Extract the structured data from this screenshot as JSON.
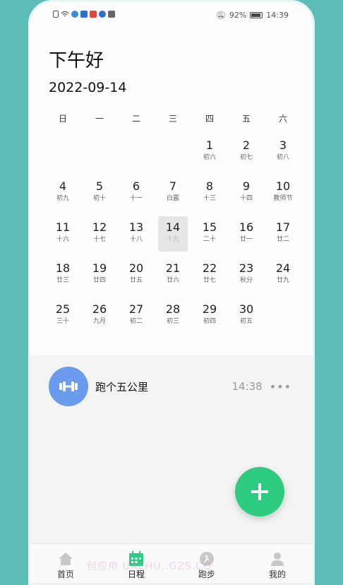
{
  "status_bar": {
    "battery": "92%",
    "time": "14:39"
  },
  "greeting": "下午好",
  "date": "2022-09-14",
  "weekdays": [
    "日",
    "一",
    "二",
    "三",
    "四",
    "五",
    "六"
  ],
  "calendar": {
    "selected_day": "14",
    "rows": [
      [
        {
          "day": "",
          "lunar": ""
        },
        {
          "day": "",
          "lunar": ""
        },
        {
          "day": "",
          "lunar": ""
        },
        {
          "day": "",
          "lunar": ""
        },
        {
          "day": "1",
          "lunar": "初六"
        },
        {
          "day": "2",
          "lunar": "初七"
        },
        {
          "day": "3",
          "lunar": "初八"
        }
      ],
      [
        {
          "day": "4",
          "lunar": "初九"
        },
        {
          "day": "5",
          "lunar": "初十"
        },
        {
          "day": "6",
          "lunar": "十一"
        },
        {
          "day": "7",
          "lunar": "白露"
        },
        {
          "day": "8",
          "lunar": "十三"
        },
        {
          "day": "9",
          "lunar": "十四"
        },
        {
          "day": "10",
          "lunar": "教师节"
        }
      ],
      [
        {
          "day": "11",
          "lunar": "十六"
        },
        {
          "day": "12",
          "lunar": "十七"
        },
        {
          "day": "13",
          "lunar": "十八"
        },
        {
          "day": "14",
          "lunar": "十九"
        },
        {
          "day": "15",
          "lunar": "二十"
        },
        {
          "day": "16",
          "lunar": "廿一"
        },
        {
          "day": "17",
          "lunar": "廿二"
        }
      ],
      [
        {
          "day": "18",
          "lunar": "廿三"
        },
        {
          "day": "19",
          "lunar": "廿四"
        },
        {
          "day": "20",
          "lunar": "廿五"
        },
        {
          "day": "21",
          "lunar": "廿六"
        },
        {
          "day": "22",
          "lunar": "廿七"
        },
        {
          "day": "23",
          "lunar": "秋分"
        },
        {
          "day": "24",
          "lunar": "廿九"
        }
      ],
      [
        {
          "day": "25",
          "lunar": "三十"
        },
        {
          "day": "26",
          "lunar": "九月"
        },
        {
          "day": "27",
          "lunar": "初二"
        },
        {
          "day": "28",
          "lunar": "初三"
        },
        {
          "day": "29",
          "lunar": "初四"
        },
        {
          "day": "30",
          "lunar": "初五"
        },
        {
          "day": "",
          "lunar": ""
        }
      ]
    ]
  },
  "event": {
    "icon": "dumbbell-icon",
    "title": "跑个五公里",
    "time": "14:38",
    "more": "•••"
  },
  "fab": {
    "icon": "plus-icon"
  },
  "tabs": [
    {
      "label": "首页",
      "icon": "home-icon"
    },
    {
      "label": "日程",
      "icon": "calendar-icon",
      "active": true
    },
    {
      "label": "跑步",
      "icon": "running-icon"
    },
    {
      "label": "我的",
      "icon": "profile-icon"
    }
  ],
  "watermark": "创应用 UACHU..GZS.CO",
  "colors": {
    "background": "#5bbcb8",
    "accent_green": "#2ecc80",
    "event_blue": "#6b9bec",
    "selected_bg": "#e6e6e6"
  }
}
